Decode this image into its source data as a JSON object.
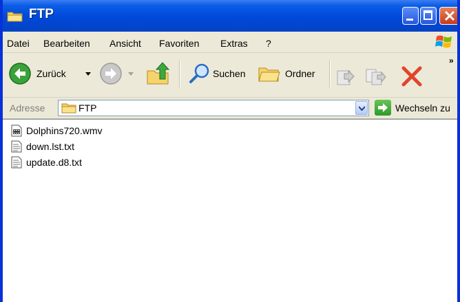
{
  "window": {
    "title": "FTP"
  },
  "menu": [
    {
      "label": "Datei"
    },
    {
      "label": "Bearbeiten"
    },
    {
      "label": "Ansicht"
    },
    {
      "label": "Favoriten"
    },
    {
      "label": "Extras"
    },
    {
      "label": "?"
    }
  ],
  "toolbar": {
    "back_label": "Zurück",
    "search_label": "Suchen",
    "folders_label": "Ordner"
  },
  "address": {
    "label": "Adresse",
    "value": "FTP",
    "go_label": "Wechseln zu"
  },
  "files": [
    {
      "name": "Dolphins720.wmv",
      "icon": "video-file-icon"
    },
    {
      "name": "down.lst.txt",
      "icon": "text-file-icon"
    },
    {
      "name": "update.d8.txt",
      "icon": "text-file-icon"
    }
  ],
  "colors": {
    "titlebar": "#0054e3",
    "frame": "#0831d9",
    "chrome": "#ece9d8",
    "close": "#e0452b"
  }
}
